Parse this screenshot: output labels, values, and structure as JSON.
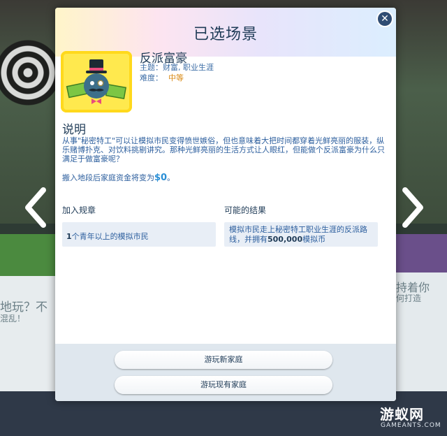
{
  "background": {
    "left_text": "地玩？不",
    "left_text2": "混乱！",
    "right_text": "持着你",
    "right_text2": "何打造"
  },
  "dialog": {
    "title": "已选场景",
    "close_icon": "close-icon",
    "scenario": {
      "name": "反派富豪",
      "theme_label": "主题：",
      "theme_value": "财富, 职业生涯",
      "difficulty_label": "难度：",
      "difficulty_value": "中等",
      "icon": "villain-tycoon-icon"
    },
    "description": {
      "heading": "说明",
      "text": "从事\"秘密特工\"可以让模拟市民变得愤世嫉俗，但也意味着大把时间都穿着光鲜亮丽的服装，纵乐赌博扑克、对饮料挑剔讲究。那种光鲜亮丽的生活方式让人眼红，但能做个反派富豪为什么只满足于做富豪呢？",
      "funds_text": "搬入地段后家庭资金将变为",
      "funds_symbol": "$",
      "funds_amount": "0",
      "funds_suffix": "。"
    },
    "join_rules": {
      "heading": "加入规章",
      "count": "1",
      "text": "个青年以上的模拟市民"
    },
    "possible_results": {
      "heading": "可能的结果",
      "text_before": "模拟市民走上秘密特工职业生涯的反派路线，并拥有",
      "amount": "500,000",
      "text_after": "模拟币"
    },
    "buttons": {
      "play_new": "游玩新家庭",
      "play_existing": "游玩现有家庭"
    }
  },
  "nav": {
    "prev_icon": "chevron-left-icon",
    "next_icon": "chevron-right-icon"
  },
  "watermark": {
    "logo": "游蚁网",
    "sub": "GAMEANTS.COM"
  },
  "colors": {
    "title": "#1f3b57",
    "body_text": "#2d5f9e",
    "difficulty": "#d98a14",
    "funds_amount": "#2a8fd6",
    "footer": "#dfe7ee"
  }
}
